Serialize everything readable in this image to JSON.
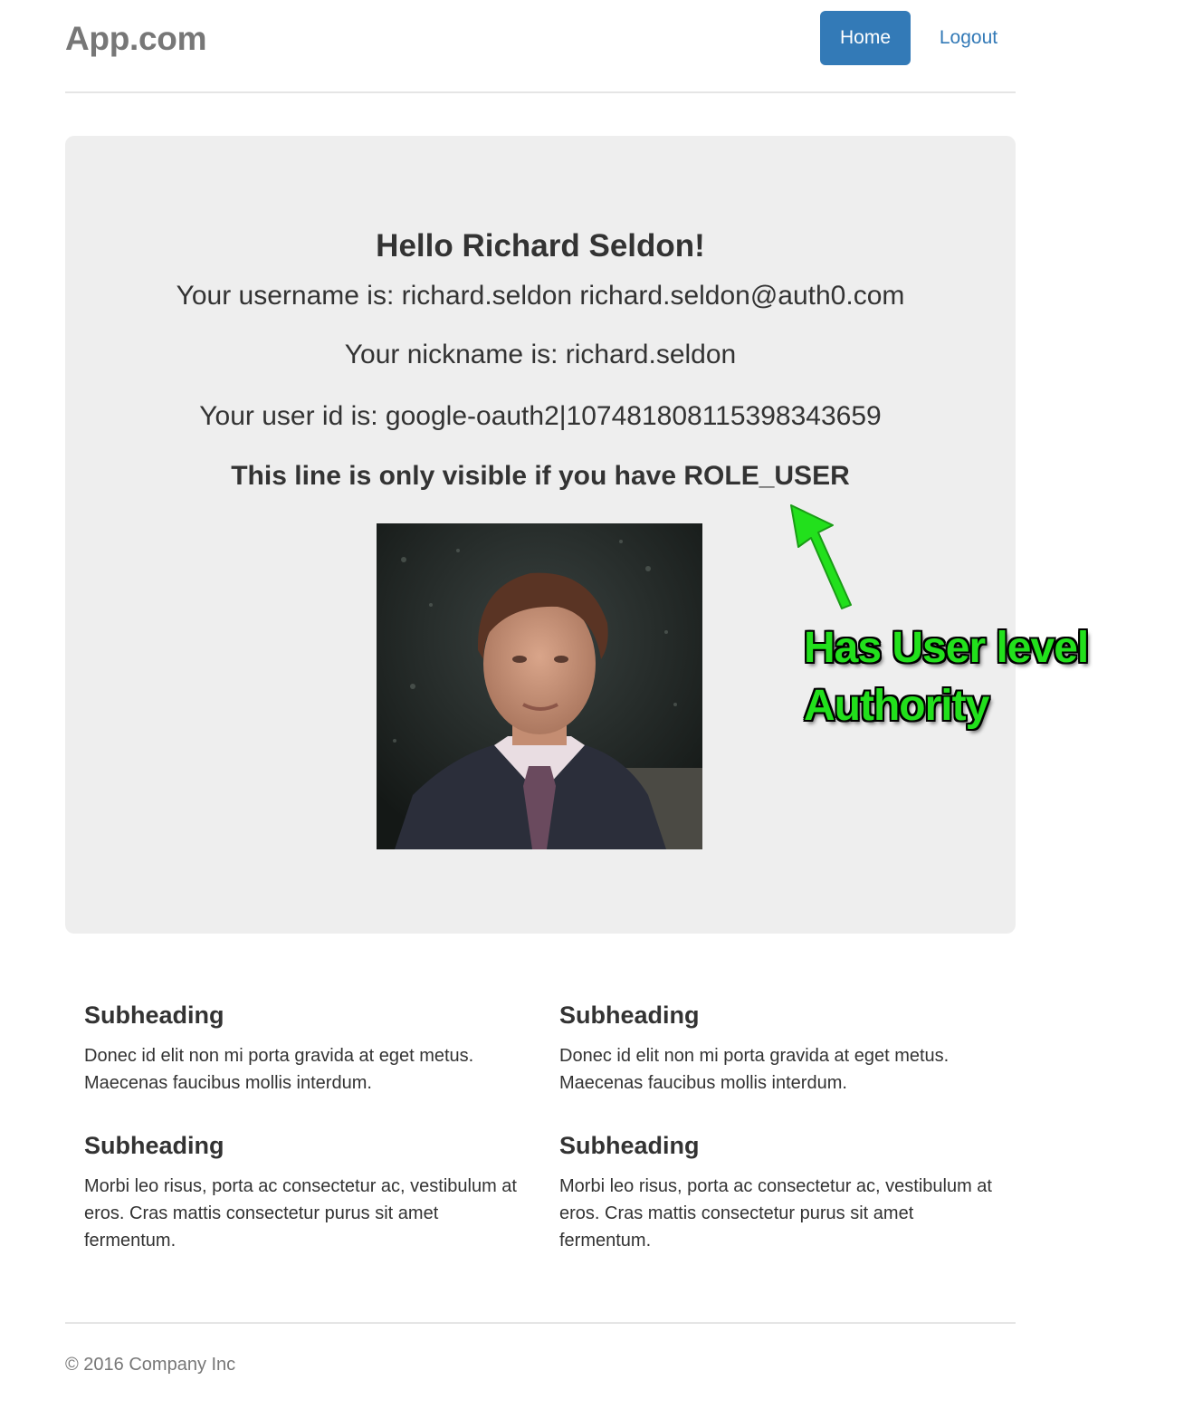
{
  "header": {
    "brand": "App.com",
    "nav": {
      "home_label": "Home",
      "logout_label": "Logout"
    }
  },
  "jumbotron": {
    "greeting": "Hello Richard Seldon!",
    "username_line": "Your username is: richard.seldon richard.seldon@auth0.com",
    "nickname_line": "Your nickname is: richard.seldon",
    "userid_line": "Your user id is: google-oauth2|107481808115398343659",
    "role_line": "This line is only visible if you have ROLE_USER"
  },
  "annotation": {
    "line1": "Has User level",
    "line2": "Authority",
    "color": "#22e01c"
  },
  "sections": [
    {
      "heading": "Subheading",
      "body": "Donec id elit non mi porta gravida at eget metus. Maecenas faucibus mollis interdum."
    },
    {
      "heading": "Subheading",
      "body": "Donec id elit non mi porta gravida at eget metus. Maecenas faucibus mollis interdum."
    },
    {
      "heading": "Subheading",
      "body": "Morbi leo risus, porta ac consectetur ac, vestibulum at eros. Cras mattis consectetur purus sit amet fermentum."
    },
    {
      "heading": "Subheading",
      "body": "Morbi leo risus, porta ac consectetur ac, vestibulum at eros. Cras mattis consectetur purus sit amet fermentum."
    }
  ],
  "footer": {
    "copyright": "© 2016 Company Inc"
  },
  "colors": {
    "primary": "#337ab7",
    "jumbotron_bg": "#eeeeee",
    "muted_text": "#777777"
  }
}
